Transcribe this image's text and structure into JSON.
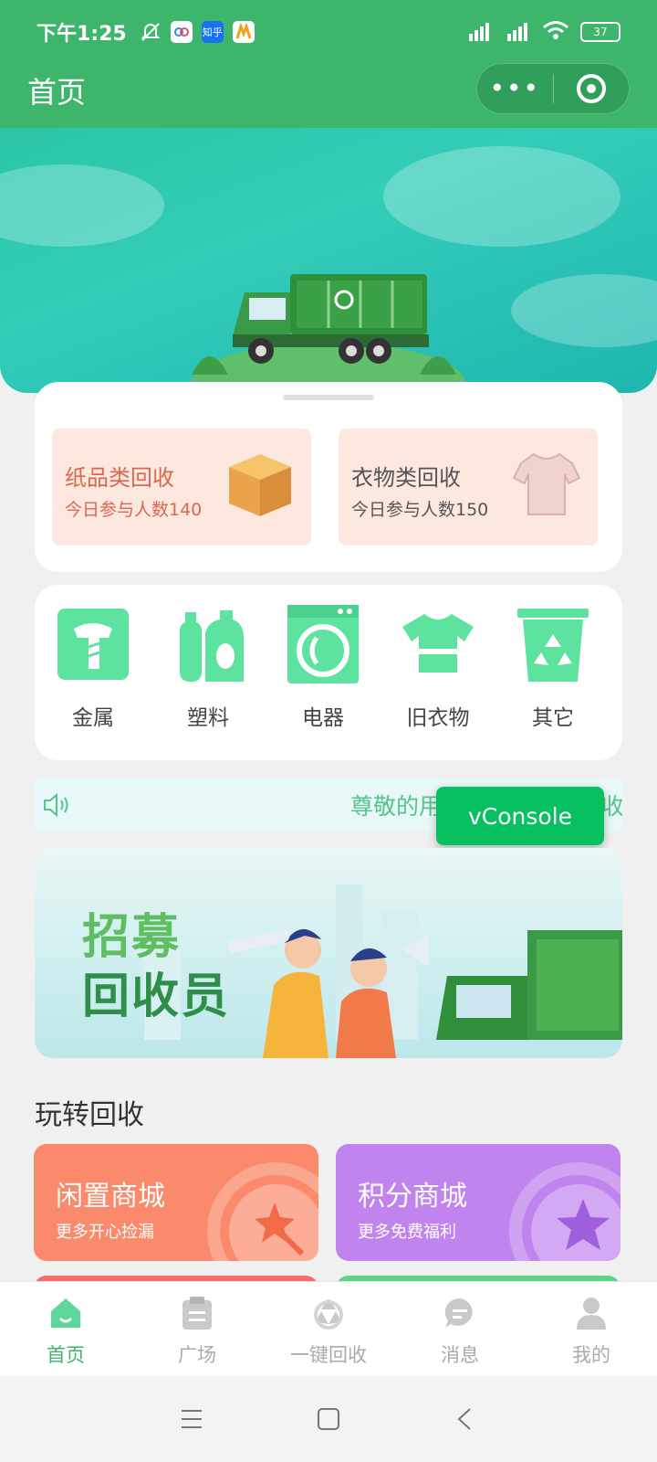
{
  "status_bar": {
    "time": "下午1:25",
    "app_badge": "知乎",
    "battery": "37",
    "signal1": "HD",
    "signal2": "HD"
  },
  "navbar": {
    "title": "首页",
    "more_label": "•••"
  },
  "recycle_cards": [
    {
      "title": "纸品类回收",
      "subtitle": "今日参与人数140"
    },
    {
      "title": "衣物类回收",
      "subtitle": "今日参与人数150"
    }
  ],
  "categories": [
    {
      "label": "金属",
      "icon": "screw-icon"
    },
    {
      "label": "塑料",
      "icon": "plastic-bottle-icon"
    },
    {
      "label": "电器",
      "icon": "washing-machine-icon"
    },
    {
      "label": "旧衣物",
      "icon": "shirt-icon"
    },
    {
      "label": "其它",
      "icon": "recycle-bin-icon"
    }
  ],
  "notice": {
    "text": "尊敬的用户，欢迎使用回收小程序 广"
  },
  "vconsole": {
    "label": "vConsole"
  },
  "recruit_banner": {
    "line1": "招募",
    "line2": "回收员"
  },
  "section_title": "玩转回收",
  "malls": [
    {
      "title": "闲置商城",
      "subtitle": "更多开心捡漏",
      "color": "#fa8a6b"
    },
    {
      "title": "积分商城",
      "subtitle": "更多免费福利",
      "color": "#c184ee"
    }
  ],
  "tabbar": [
    {
      "label": "首页",
      "icon": "home-icon",
      "active": true
    },
    {
      "label": "广场",
      "icon": "clipboard-icon",
      "active": false
    },
    {
      "label": "一键回收",
      "icon": "recycle-icon",
      "active": false
    },
    {
      "label": "消息",
      "icon": "chat-icon",
      "active": false
    },
    {
      "label": "我的",
      "icon": "user-icon",
      "active": false
    }
  ],
  "colors": {
    "primary": "#3db66c",
    "accent_green": "#5ee2a0",
    "vconsole": "#07c160"
  }
}
